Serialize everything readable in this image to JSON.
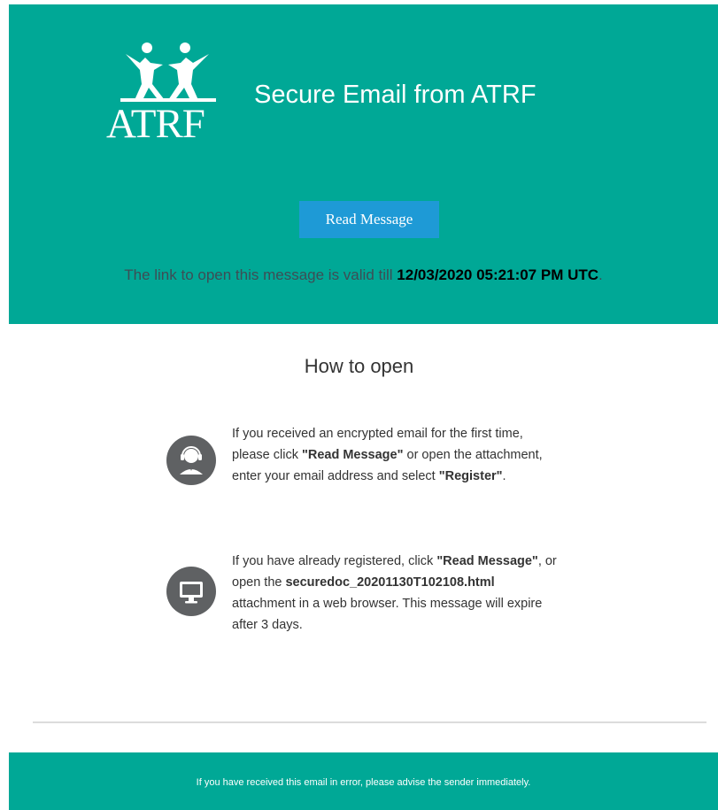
{
  "brand": {
    "logo_text": "ATRF",
    "color_primary": "#00a896",
    "color_button": "#1e9ad6"
  },
  "header": {
    "title": "Secure Email from ATRF",
    "read_button_label": "Read Message",
    "validity_prefix": "The link to open this message is valid till ",
    "validity_datetime": "12/03/2020 05:21:07 PM UTC",
    "validity_suffix": "."
  },
  "how_to_open": {
    "title": "How to open",
    "steps": [
      {
        "icon": "support-agent-icon",
        "t1": "If you received an encrypted email for the first time, please click ",
        "b1": "\"Read Message\"",
        "t2": " or open the attachment, enter your email address and select ",
        "b2": "\"Register\"",
        "t3": "."
      },
      {
        "icon": "monitor-icon",
        "t1": "If you have already registered, click ",
        "b1": "\"Read Message\"",
        "t2": ", or open the ",
        "b2": "securedoc_20201130T102108.html",
        "t3": " attachment in a web browser. This message will expire after 3 days."
      }
    ]
  },
  "footer": {
    "text": "If you have received this email in error, please advise the sender immediately."
  }
}
